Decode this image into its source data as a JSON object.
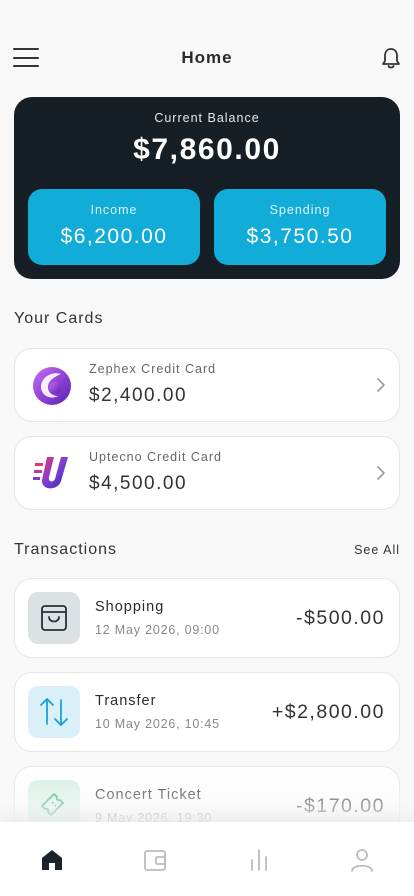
{
  "header": {
    "title": "Home"
  },
  "balance": {
    "label": "Current Balance",
    "value": "$7,860.00",
    "income_label": "Income",
    "income_value": "$6,200.00",
    "spending_label": "Spending",
    "spending_value": "$3,750.50"
  },
  "cards_section": {
    "title": "Your Cards"
  },
  "cards": [
    {
      "name": "Zephex Credit Card",
      "amount": "$2,400.00",
      "icon": "zephex-logo-icon"
    },
    {
      "name": "Uptecno Credit Card",
      "amount": "$4,500.00",
      "icon": "uptecno-logo-icon"
    }
  ],
  "transactions_section": {
    "title": "Transactions",
    "see_all": "See All"
  },
  "transactions": [
    {
      "name": "Shopping",
      "date": "12 May 2026, 09:00",
      "amount": "-$500.00",
      "icon": "shopping-bag-icon"
    },
    {
      "name": "Transfer",
      "date": "10 May 2026, 10:45",
      "amount": "+$2,800.00",
      "icon": "transfer-arrows-icon"
    },
    {
      "name": "Concert Ticket",
      "date": "9 May 2026, 19:30",
      "amount": "-$170.00",
      "icon": "ticket-icon"
    }
  ],
  "tabs": [
    {
      "name": "home",
      "icon": "home-icon",
      "active": true
    },
    {
      "name": "wallet",
      "icon": "wallet-icon",
      "active": false
    },
    {
      "name": "stats",
      "icon": "chart-icon",
      "active": false
    },
    {
      "name": "profile",
      "icon": "user-icon",
      "active": false
    }
  ],
  "colors": {
    "accent": "#12acd9",
    "balance_bg": "#161e26",
    "page_bg": "#f8f8f8"
  }
}
